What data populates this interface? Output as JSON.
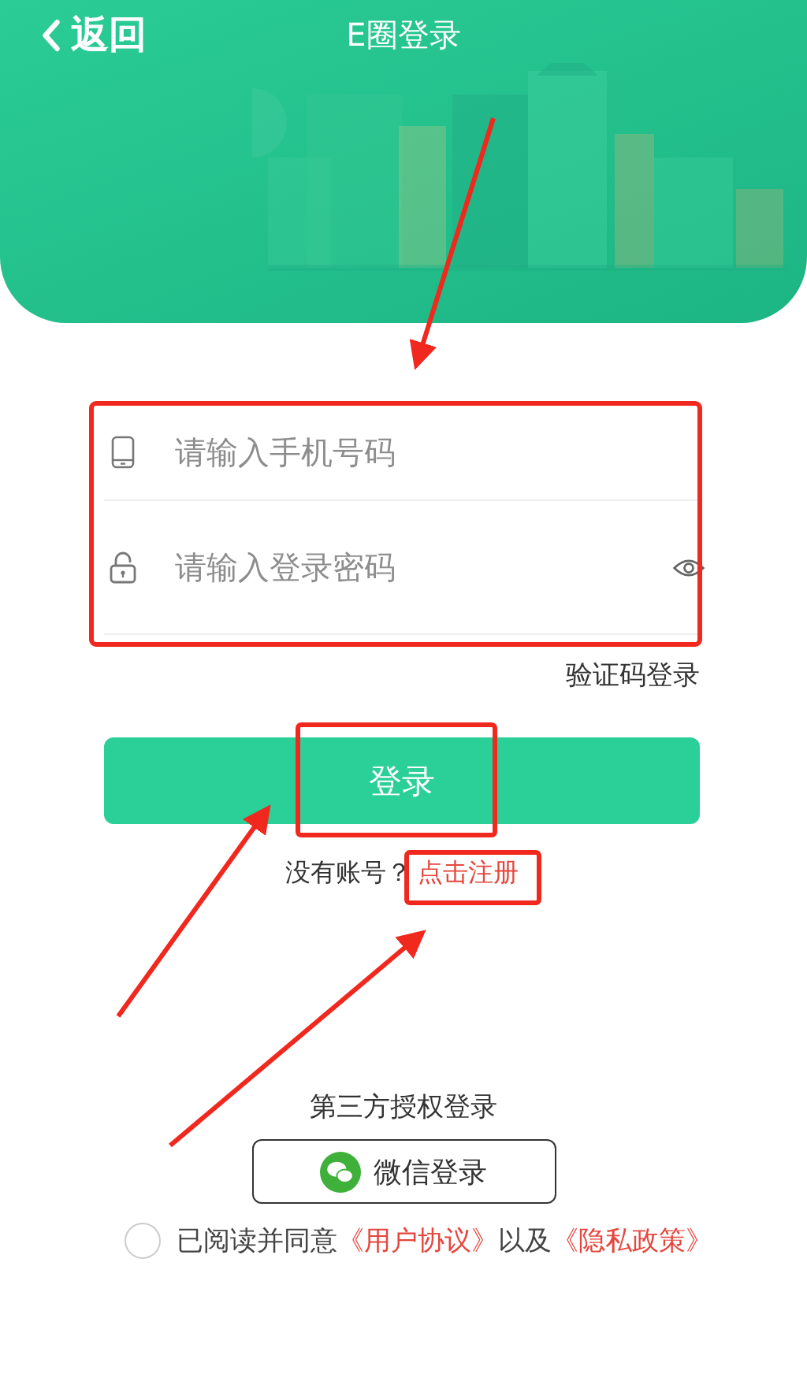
{
  "nav": {
    "back_label": "返回",
    "title": "E圈登录"
  },
  "form": {
    "fields": [
      {
        "kind": "phone",
        "placeholder": "请输入手机号码"
      },
      {
        "kind": "password",
        "placeholder": "请输入登录密码"
      }
    ],
    "sms_login": "验证码登录",
    "submit": "登录"
  },
  "signup": {
    "prompt": "没有账号？",
    "link": "点击注册"
  },
  "third_party": {
    "title": "第三方授权登录",
    "wechat": "微信登录"
  },
  "agreement": {
    "checked": false,
    "parts": [
      {
        "kind": "text",
        "text": "已阅读并同意"
      },
      {
        "kind": "link",
        "text": "《用户协议》"
      },
      {
        "kind": "text",
        "text": "以及"
      },
      {
        "kind": "link",
        "text": "《隐私政策》"
      }
    ]
  }
}
